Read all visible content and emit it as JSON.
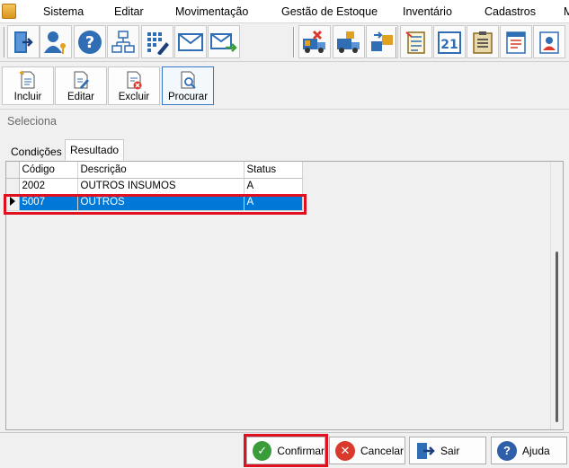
{
  "menu": {
    "items": [
      "Sistema",
      "Editar",
      "Movimentação",
      "Gestão de Estoque",
      "Inventário",
      "Cadastros",
      "M"
    ]
  },
  "toolbar_icons": [
    "exit-door-icon",
    "user-key-icon",
    "help-icon",
    "org-chart-icon",
    "calculator-pen-icon",
    "mail-icon",
    "mail-send-icon",
    "truck-cancel-icon",
    "truck-box-icon",
    "boxes-transfer-icon",
    "checklist-icon",
    "calendar-21-icon",
    "clipboard-list-icon",
    "report-icon",
    "user-card-icon"
  ],
  "actions": {
    "incluir": "Incluir",
    "editar": "Editar",
    "excluir": "Excluir",
    "procurar": "Procurar"
  },
  "panel": {
    "title": "Seleciona",
    "tabs": [
      "Condições",
      "Resultado"
    ],
    "active_tab": "Resultado"
  },
  "grid": {
    "columns": [
      "Código",
      "Descrição",
      "Status"
    ],
    "rows": [
      {
        "codigo": "2002",
        "descricao": "OUTROS INSUMOS",
        "status": "A"
      },
      {
        "codigo": "5007",
        "descricao": "OUTROS",
        "status": "A"
      }
    ],
    "selected_row": 1
  },
  "buttons": {
    "confirmar": "Confirmar",
    "cancelar": "Cancelar",
    "sair": "Sair",
    "ajuda": "Ajuda"
  },
  "colors": {
    "selection": "#0078d7",
    "highlight": "#e01020",
    "confirm": "#3a9d3a",
    "cancel": "#d93a2b",
    "help": "#2f5fa8"
  }
}
